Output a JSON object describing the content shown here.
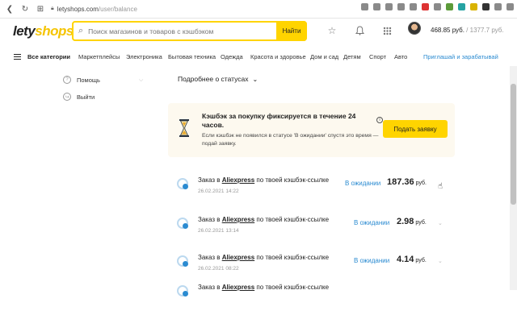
{
  "browser": {
    "url_domain": "letyshops.com",
    "url_path": "/user/balance"
  },
  "header": {
    "logo_main": "lety",
    "logo_accent": "shops",
    "search_placeholder": "Поиск магазинов и товаров с кэшбэком",
    "search_button": "Найти",
    "balance_confirmed": "468.85 руб.",
    "balance_separator": " / ",
    "balance_pending": "1377.7 руб."
  },
  "categories": {
    "all_label": "Все категории",
    "items": [
      "Маркетплейсы",
      "Электроника",
      "Бытовая техника",
      "Одежда",
      "Красота и здоровье",
      "Дом и сад",
      "Детям",
      "Спорт",
      "Авто"
    ],
    "invite": "Приглашай и зарабатывай"
  },
  "sidebar": {
    "help": "Помощь",
    "logout": "Выйти"
  },
  "main": {
    "details_link": "Подробнее о статусах",
    "notice": {
      "title": "Кэшбэк за покупку фиксируется в течение 24 часов.",
      "body": "Если кэшбэк не появился в статусе 'В ожидании' спустя это время — подай заявку.",
      "button": "Подать заявку"
    },
    "orders": [
      {
        "prefix": "Заказ в ",
        "store": "Aliexpress",
        "suffix": " по твоей кэшбэк-ссылке",
        "date": "26.02.2021 14:22",
        "status": "В ожидании",
        "amount": "187.36",
        "currency": "руб."
      },
      {
        "prefix": "Заказ в ",
        "store": "Aliexpress",
        "suffix": " по твоей кэшбэк-ссылке",
        "date": "26.02.2021 13:14",
        "status": "В ожидании",
        "amount": "2.98",
        "currency": "руб."
      },
      {
        "prefix": "Заказ в ",
        "store": "Aliexpress",
        "suffix": " по твоей кэшбэк-ссылке",
        "date": "26.02.2021 08:22",
        "status": "В ожидании",
        "amount": "4.14",
        "currency": "руб."
      },
      {
        "prefix": "Заказ в ",
        "store": "Aliexpress",
        "suffix": " по твоей кэшбэк-ссылке",
        "date": "",
        "status": "",
        "amount": "",
        "currency": ""
      }
    ]
  },
  "colors": {
    "accent_yellow": "#ffd400",
    "link_blue": "#2b8bd1",
    "notice_bg": "#fdf9ef"
  }
}
